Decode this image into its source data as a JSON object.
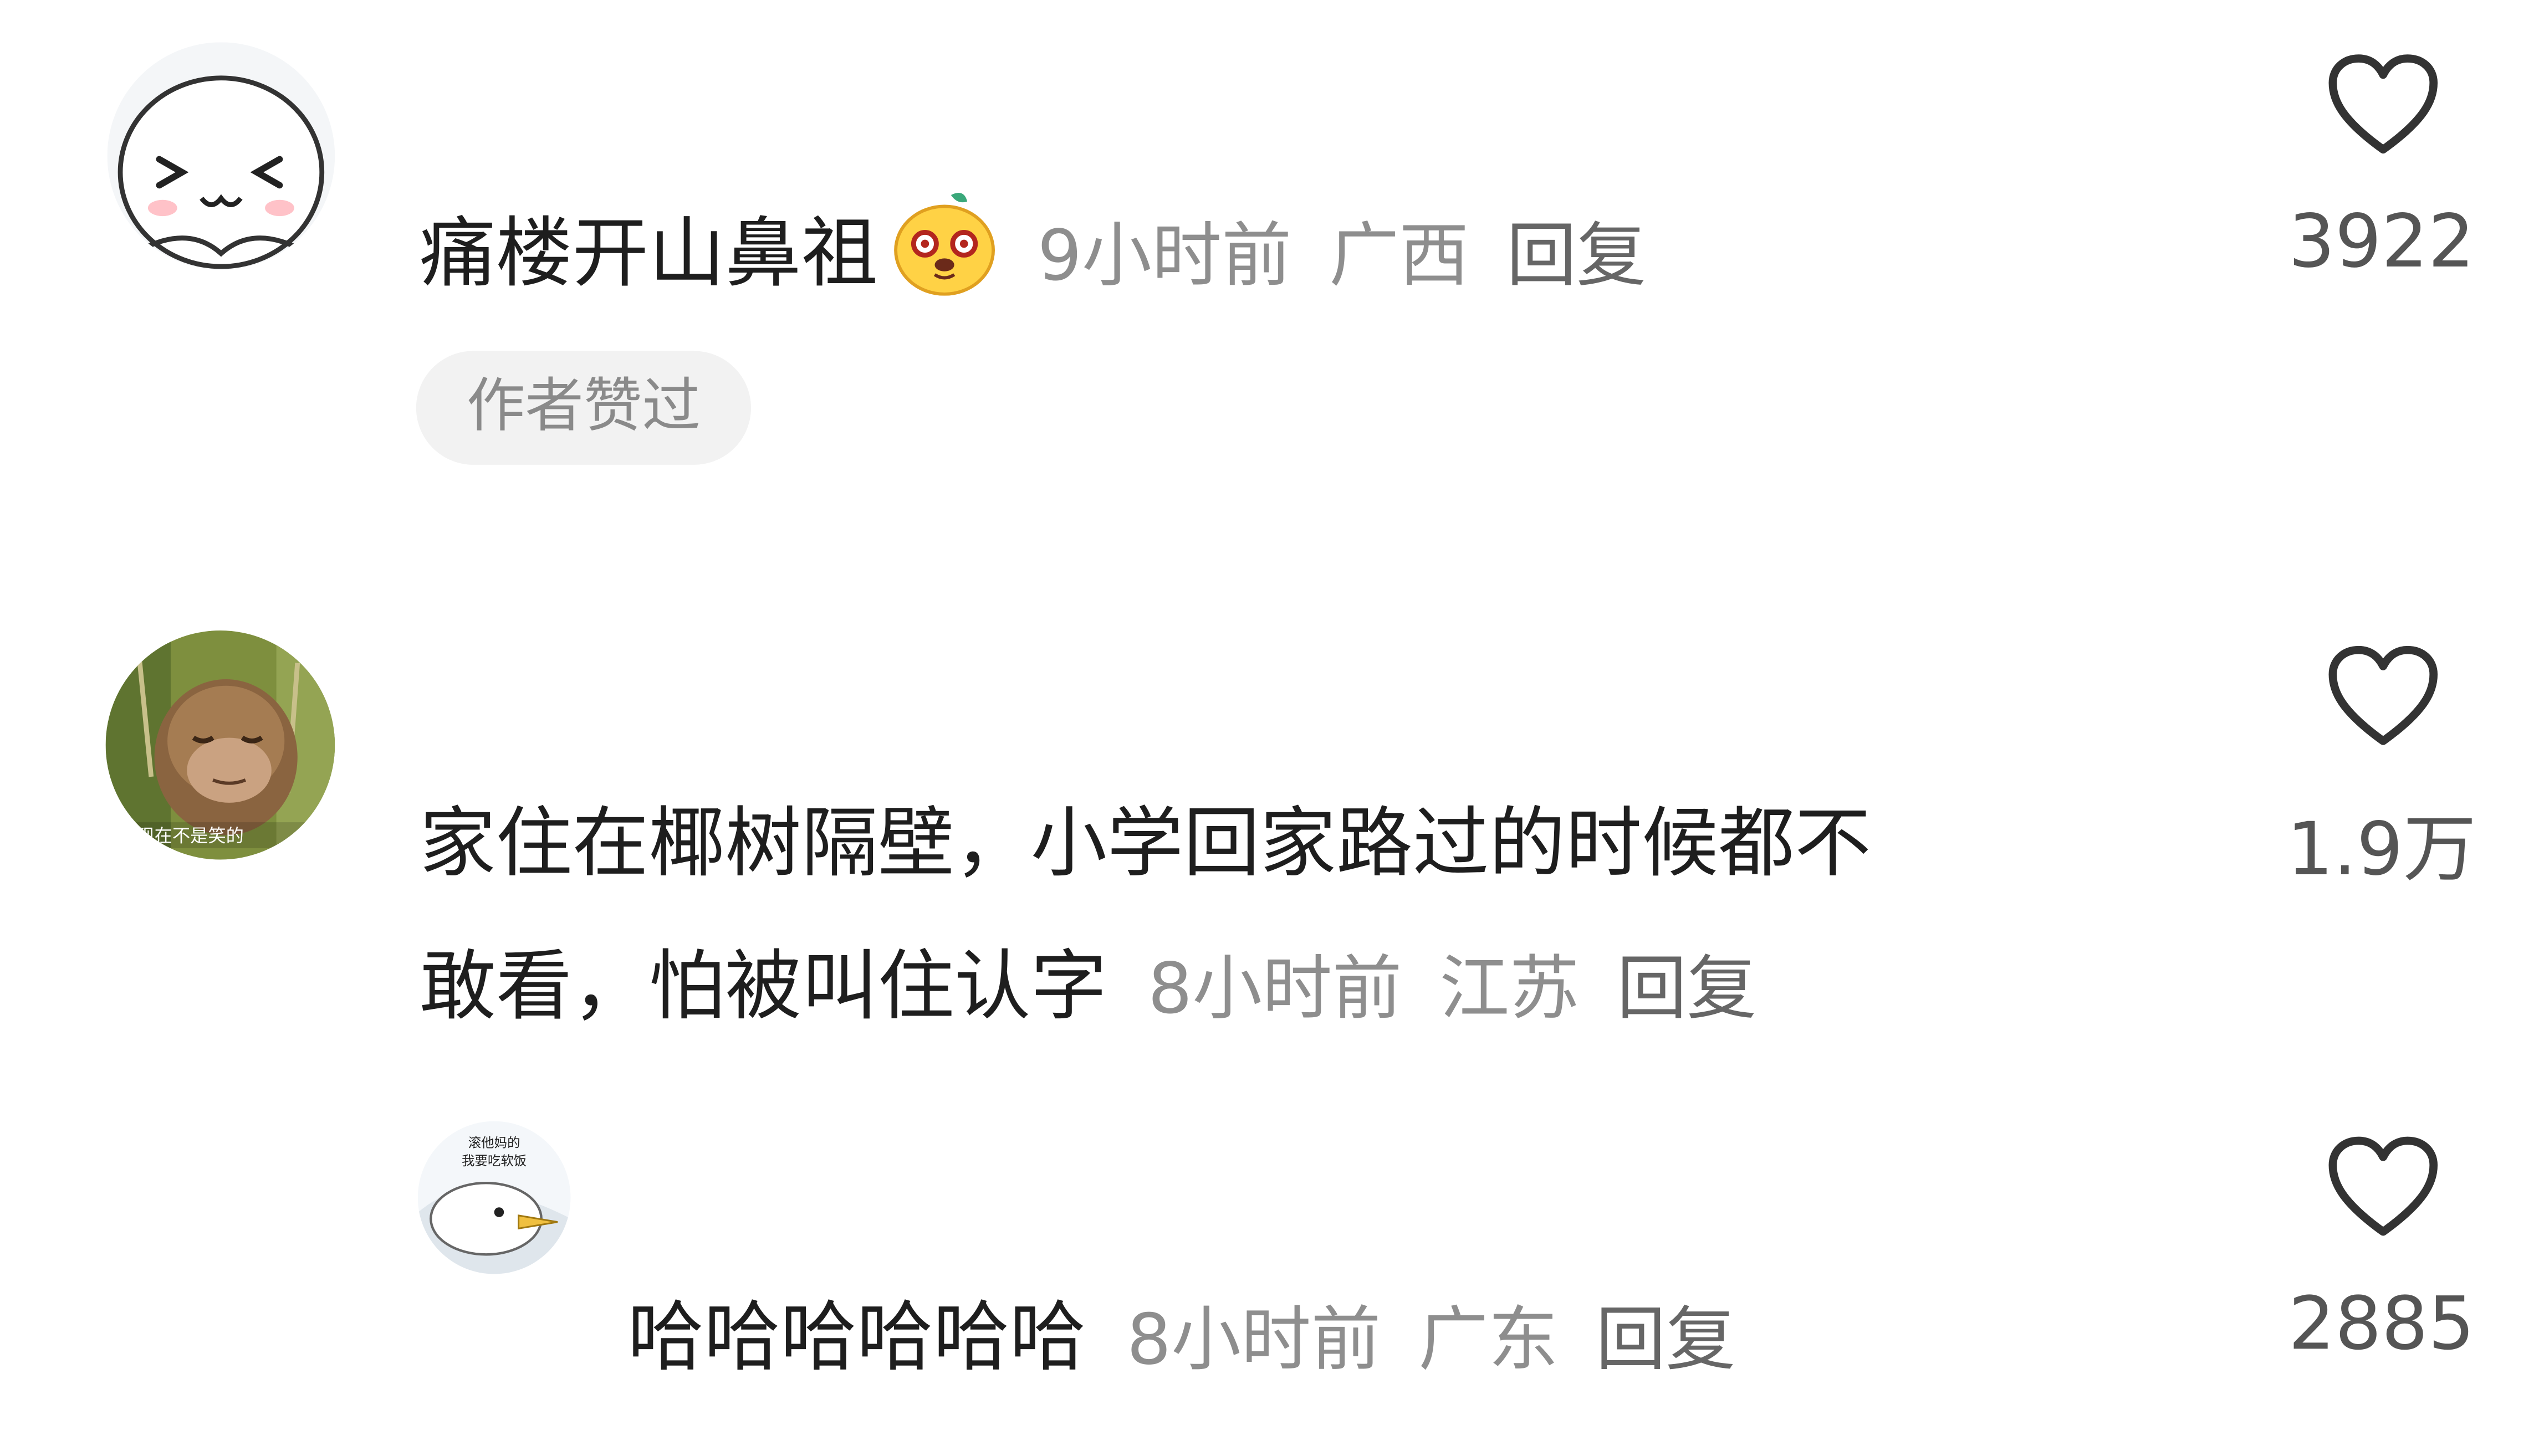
{
  "comments": [
    {
      "text": "痛楼开山鼻祖",
      "time": "9小时前",
      "region": "广西",
      "reply_label": "回复",
      "likes": "3922",
      "badge": "作者赞过",
      "avatar_icon": "cute-face-avatar",
      "emoji_icon": "smug-face-emoji"
    },
    {
      "text_line1": "家住在椰树隔壁，小学回家路过的时候都不",
      "text_line2": "敢看，怕被叫住认字",
      "time": "8小时前",
      "region": "江苏",
      "reply_label": "回复",
      "likes": "1.9万",
      "avatar_icon": "monkey-photo-avatar",
      "avatar_caption": "我现在不是笑的"
    },
    {
      "text": "哈哈哈哈哈哈",
      "time": "8小时前",
      "region": "广东",
      "reply_label": "回复",
      "likes": "2885",
      "avatar_icon": "seagull-meme-avatar",
      "avatar_caption_line1": "滚他妈的",
      "avatar_caption_line2": "我要吃软饭"
    }
  ],
  "icons": {
    "like": "heart-outline-icon"
  },
  "colors": {
    "text": "#1e1e1e",
    "meta": "#8e8e8e",
    "badge_bg": "#f2f2f2"
  }
}
